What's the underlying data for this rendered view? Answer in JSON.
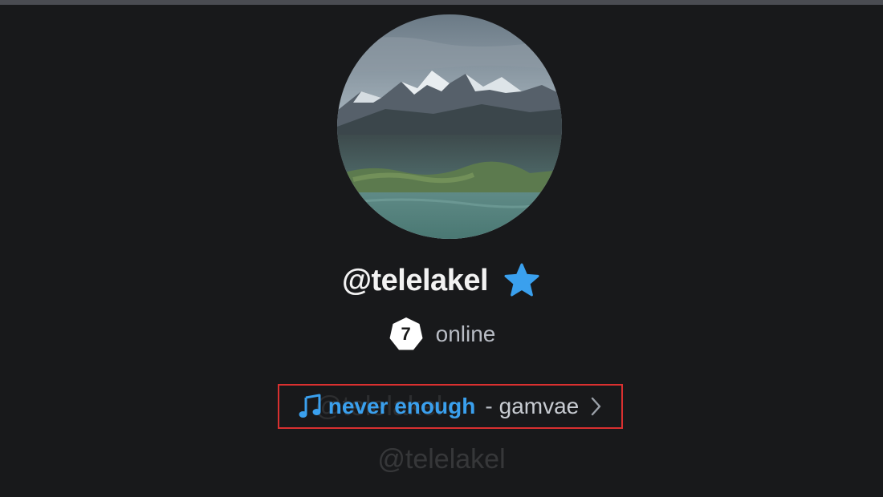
{
  "profile": {
    "username": "@telelakel",
    "badge_icon": "star-icon",
    "online_count": "7",
    "online_label": "online",
    "music": {
      "icon": "music-note-icon",
      "song_title": "never enough",
      "separator": "-",
      "artist": "gamvae",
      "chevron_icon": "chevron-right-icon"
    }
  },
  "watermark": {
    "text": "@telelakel"
  },
  "colors": {
    "background": "#18191b",
    "accent": "#3aa0ee",
    "highlight_box": "#d93030"
  }
}
